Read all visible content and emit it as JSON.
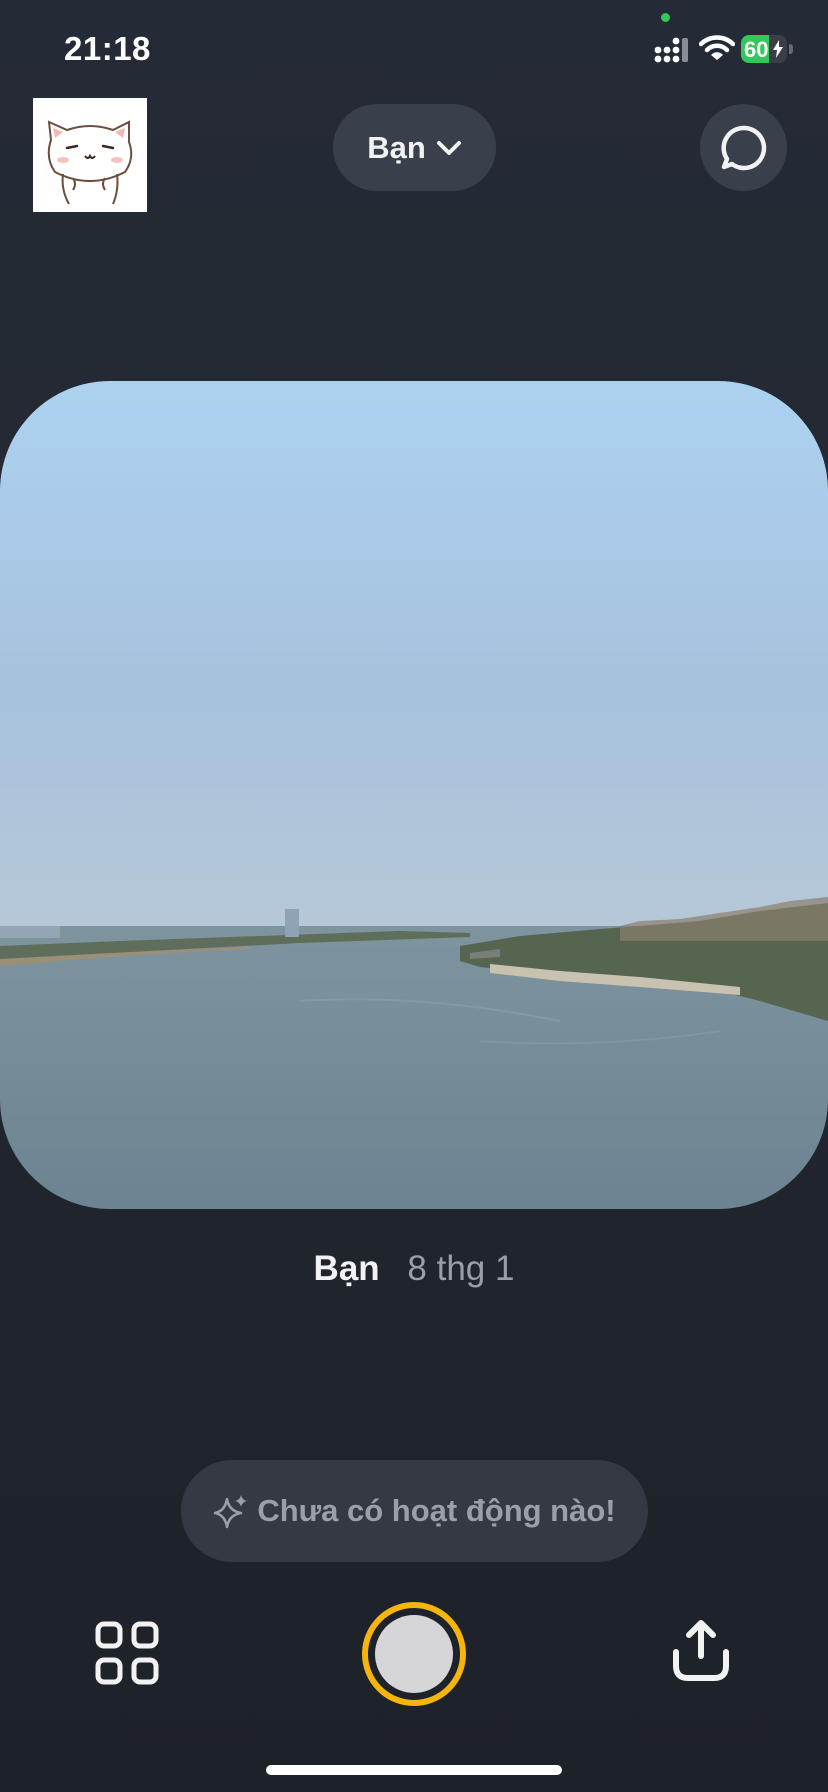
{
  "status_bar": {
    "time": "21:18",
    "battery_level": "60",
    "battery_fraction": 0.6,
    "icons": [
      "signal-icon",
      "wifi-icon",
      "battery-charging-icon"
    ]
  },
  "header": {
    "audience_label": "Bạn",
    "audience_icon": "chevron-down-icon",
    "chat_icon": "chat-bubble-icon"
  },
  "post": {
    "author": "Bạn",
    "date": "8 thg 1"
  },
  "activity": {
    "icon": "sparkle-icon",
    "text": "Chưa có hoạt động nào!"
  },
  "bottom_bar": {
    "left_icon": "grid-icon",
    "center": "shutter-button",
    "right_icon": "share-icon"
  },
  "colors": {
    "background": "#232831",
    "pill": "#3a404b",
    "shutter_ring": "#f5b50d",
    "battery": "#34c759",
    "muted_text": "#9ba0a8"
  }
}
